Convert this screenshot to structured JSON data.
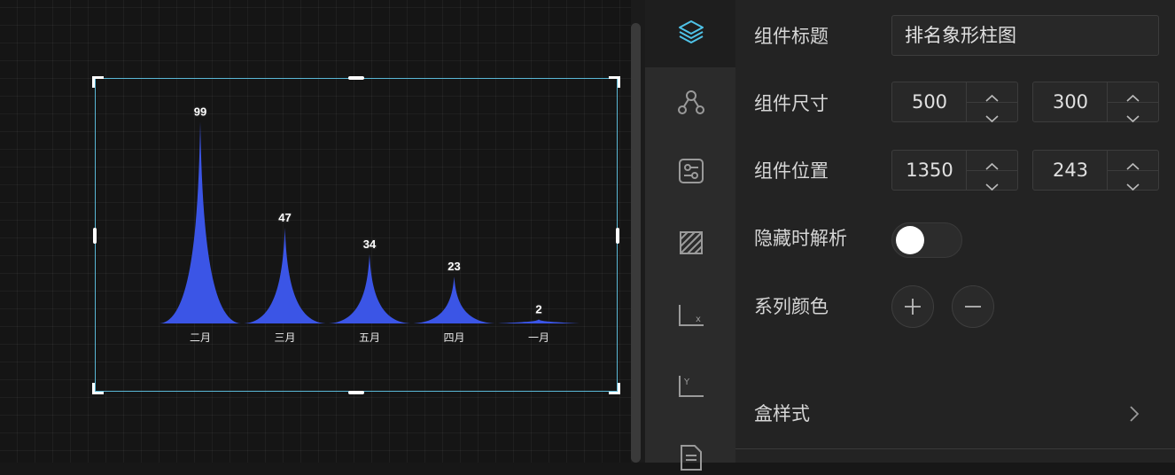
{
  "chart_data": {
    "type": "bar",
    "subtype": "pictorial-spike",
    "categories": [
      "二月",
      "三月",
      "五月",
      "四月",
      "一月"
    ],
    "values": [
      99,
      47,
      34,
      23,
      2
    ],
    "title": "",
    "xlabel": "",
    "ylabel": "",
    "ylim": [
      0,
      100
    ],
    "grid": false,
    "legend": "none",
    "bar_color": "#3b55e6",
    "label_color": "#ffffff"
  },
  "rail": {
    "icons": [
      "layers-icon",
      "connect-icon",
      "settings-sliders-icon",
      "hatch-box-icon",
      "x-axis-icon",
      "y-axis-icon",
      "list-doc-icon"
    ]
  },
  "panel": {
    "title_label": "组件标题",
    "title_value": "排名象形柱图",
    "size_label": "组件尺寸",
    "size_width": "500",
    "size_height": "300",
    "position_label": "组件位置",
    "position_x": "1350",
    "position_y": "243",
    "hide_label": "隐藏时解析",
    "hide_enabled": false,
    "series_color_label": "系列颜色",
    "box_style_label": "盒样式"
  },
  "colors": {
    "accent": "#5ab8d6",
    "panel_bg": "#232323",
    "canvas_bg": "#151515"
  }
}
